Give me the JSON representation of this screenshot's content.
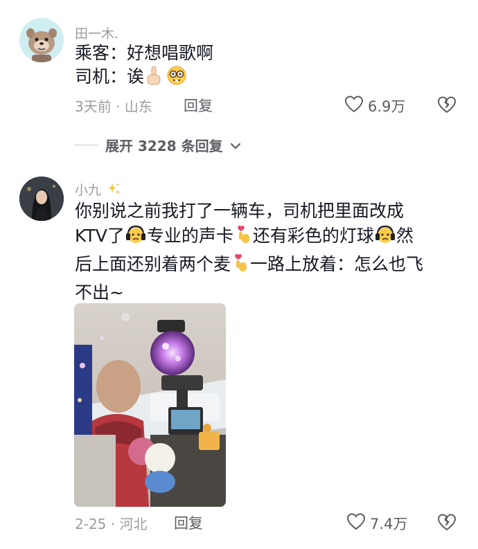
{
  "comment1": {
    "username": "田一木.",
    "lines": [
      "乘客：好想唱歌啊",
      "司机：诶"
    ],
    "date": "3天前 · 山东",
    "reply_label": "回复",
    "likes": "6.9万"
  },
  "expand_replies": {
    "label": "展开 3228 条回复"
  },
  "comment2": {
    "username": "小九",
    "lines": [
      "你别说之前我打了一辆车，司机把里面改成",
      "KTV了",
      "专业的声卡",
      "还有彩色的灯球",
      "然",
      "后上面还别着两个麦",
      "一路上放着：怎么也飞",
      "不出~"
    ],
    "date": "2-25 · 河北",
    "reply_label": "回复",
    "likes": "7.4万"
  },
  "colors": {
    "text": "#161823",
    "secondary": "#9a9ba1",
    "action": "#5c5d63"
  },
  "icons": [
    "heart-icon",
    "broken-heart-icon",
    "chevron-down-icon",
    "sparkles-icon",
    "pointing-up-emoji",
    "nerd-face-emoji",
    "headphones-face-emoji",
    "finger-heart-emoji"
  ]
}
